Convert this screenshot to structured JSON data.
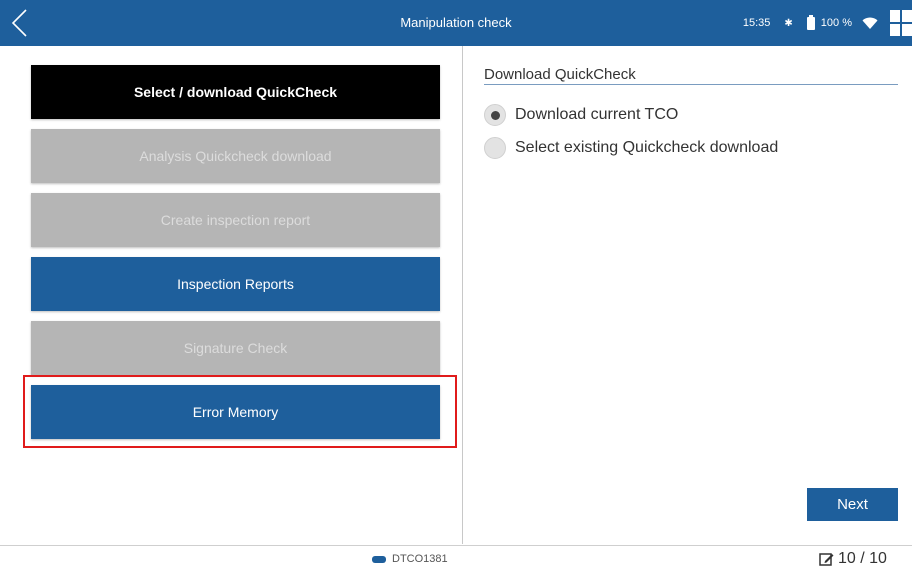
{
  "topbar": {
    "title": "Manipulation check",
    "time": "15:35",
    "battery": "100 %",
    "icons": [
      "back-arrow-icon",
      "bluetooth-icon",
      "battery-icon",
      "wifi-icon",
      "apps-grid-icon"
    ]
  },
  "menu": {
    "items": [
      {
        "label": "Select / download QuickCheck",
        "state": "selected"
      },
      {
        "label": "Analysis Quickcheck download",
        "state": "disabled"
      },
      {
        "label": "Create inspection report",
        "state": "disabled"
      },
      {
        "label": "Inspection Reports",
        "state": "enabled"
      },
      {
        "label": "Signature Check",
        "state": "disabled"
      },
      {
        "label": "Error Memory",
        "state": "enabled",
        "highlighted": true
      }
    ]
  },
  "panel": {
    "title": "Download QuickCheck",
    "options": [
      {
        "label": "Download current TCO",
        "checked": true
      },
      {
        "label": "Select existing Quickcheck download",
        "checked": false
      }
    ],
    "next_label": "Next"
  },
  "footer": {
    "device": "DTCO1381",
    "page": "10 / 10"
  },
  "colors": {
    "accent_blue": "#1e5f9c",
    "selected_black": "#000000",
    "disabled_gray": "#b5b5b5",
    "highlight_red": "#e01b1b"
  }
}
